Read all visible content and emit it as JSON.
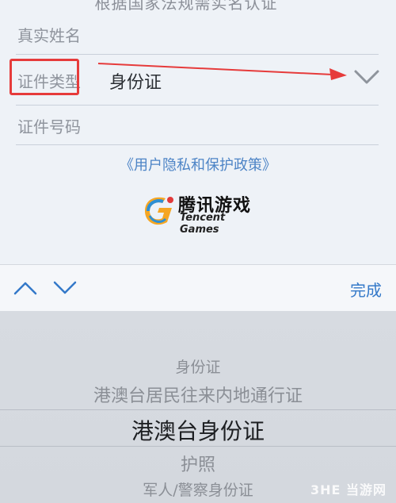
{
  "form": {
    "top_cutoff_text": "根据国家法规需实名认证",
    "real_name_label": "真实姓名",
    "id_type_label": "证件类型",
    "id_type_value": "身份证",
    "id_number_label": "证件号码",
    "privacy_link": "《用户隐私和保护政策》"
  },
  "logo": {
    "name": "腾讯游戏",
    "english": "Tencent Games"
  },
  "toolbar": {
    "done_label": "完成"
  },
  "picker": {
    "options": [
      "身份证",
      "港澳台居民往来内地通行证",
      "港澳台身份证",
      "护照",
      "军人/警察身份证"
    ],
    "selected": "港澳台身份证"
  },
  "watermark": "3HE 当游网",
  "colors": {
    "accent_blue": "#3479c9",
    "annotation_red": "#e63b3b",
    "picker_bg": "#d5d9df"
  }
}
